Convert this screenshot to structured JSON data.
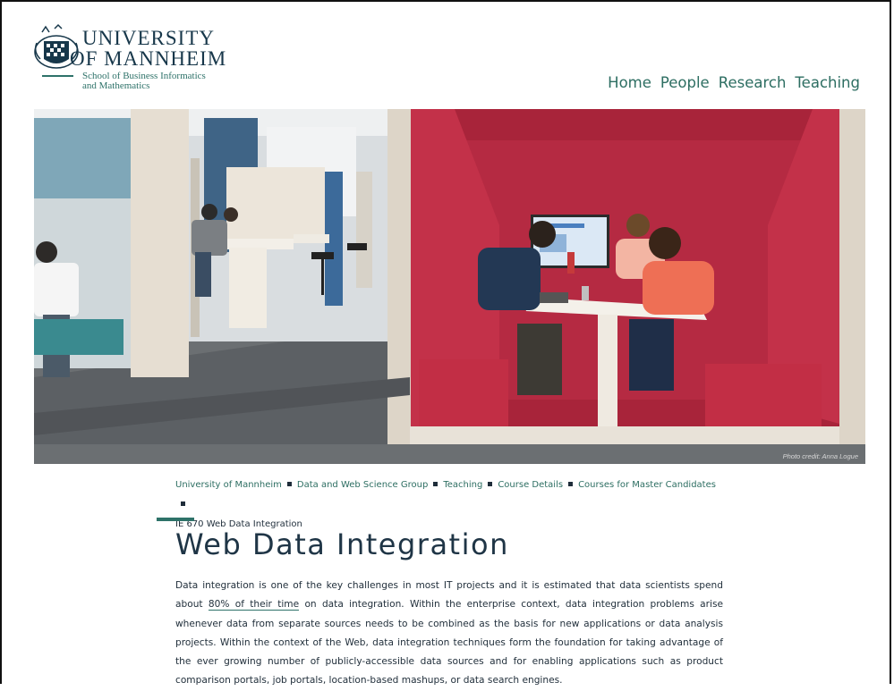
{
  "header": {
    "logo_line1": "UNIVERSITY",
    "logo_line2": "OF MANNHEIM",
    "logo_sub1": "School of Business Informatics",
    "logo_sub2": "and Mathematics"
  },
  "nav": {
    "items": [
      {
        "label": "Home"
      },
      {
        "label": "People"
      },
      {
        "label": "Research"
      },
      {
        "label": "Teaching"
      }
    ]
  },
  "hero": {
    "credit": "Photo credit: Anna Logue"
  },
  "breadcrumb": {
    "items": [
      {
        "label": "University of Mannheim"
      },
      {
        "label": "Data and Web Science Group"
      },
      {
        "label": "Teaching"
      },
      {
        "label": "Course Details"
      },
      {
        "label": "Courses for Master Candidates"
      }
    ],
    "current": "IE 670 Web Data Integration"
  },
  "page": {
    "title": "Web Data Integration",
    "para_part1": "Data integration is one of the key challenges in most IT projects and it is estimated that data scientists spend about ",
    "para_link": "80% of their time",
    "para_part2": " on data integration. Within the enterprise context, data integration problems arise whenever data from separate sources needs to be combined as the basis for new applications or data analysis projects. Within the context of the Web, data integration techniques form the foundation for taking advantage of the ever growing number of publicly-accessible data sources and for enabling applications such as product comparison portals, job portals, location-based mashups, or data search engines."
  },
  "colors": {
    "accent": "#2e7269",
    "text": "#1f3546"
  }
}
